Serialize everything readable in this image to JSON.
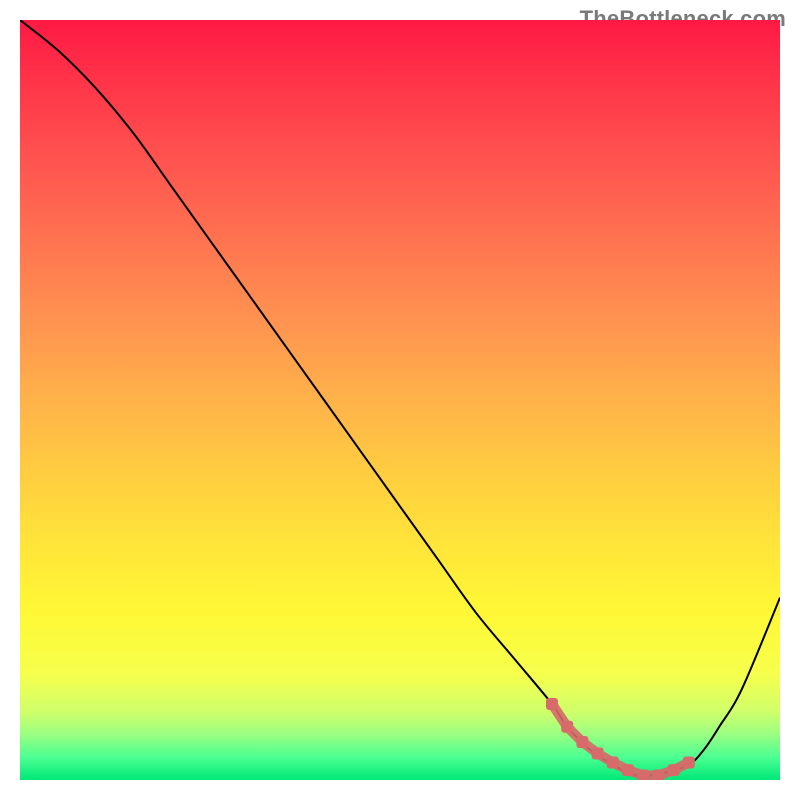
{
  "watermark": "TheBottleneck.com",
  "chart_data": {
    "type": "line",
    "title": "",
    "xlabel": "",
    "ylabel": "",
    "xlim": [
      0,
      100
    ],
    "ylim": [
      0,
      100
    ],
    "grid": false,
    "series": [
      {
        "name": "curve",
        "color": "#000000",
        "x": [
          0,
          5,
          10,
          15,
          20,
          25,
          30,
          35,
          40,
          45,
          50,
          55,
          60,
          65,
          70,
          72,
          75,
          78,
          80,
          82,
          85,
          88,
          90,
          92,
          95,
          100
        ],
        "y": [
          100,
          96,
          91,
          85,
          78,
          71,
          64,
          57,
          50,
          43,
          36,
          29,
          22,
          16,
          10,
          7,
          4,
          2,
          1,
          0.5,
          1,
          2,
          4,
          7,
          12,
          24
        ]
      },
      {
        "name": "highlight",
        "color": "#d76a6a",
        "thick": true,
        "x": [
          70,
          72,
          74,
          76,
          78,
          80,
          82,
          84,
          86,
          88
        ],
        "y": [
          10,
          7,
          5,
          3.5,
          2.3,
          1.3,
          0.6,
          0.6,
          1.3,
          2.3
        ]
      }
    ],
    "background_gradient": {
      "stops": [
        {
          "offset": 0.0,
          "color": "#ff1944"
        },
        {
          "offset": 0.1,
          "color": "#ff3a4a"
        },
        {
          "offset": 0.2,
          "color": "#ff5850"
        },
        {
          "offset": 0.3,
          "color": "#ff7650"
        },
        {
          "offset": 0.4,
          "color": "#ff9450"
        },
        {
          "offset": 0.5,
          "color": "#ffb24a"
        },
        {
          "offset": 0.6,
          "color": "#ffce3f"
        },
        {
          "offset": 0.7,
          "color": "#ffe739"
        },
        {
          "offset": 0.78,
          "color": "#fff835"
        },
        {
          "offset": 0.86,
          "color": "#f6ff4c"
        },
        {
          "offset": 0.91,
          "color": "#d0ff6a"
        },
        {
          "offset": 0.94,
          "color": "#9aff82"
        },
        {
          "offset": 0.97,
          "color": "#4cff92"
        },
        {
          "offset": 1.0,
          "color": "#00e878"
        }
      ]
    }
  }
}
